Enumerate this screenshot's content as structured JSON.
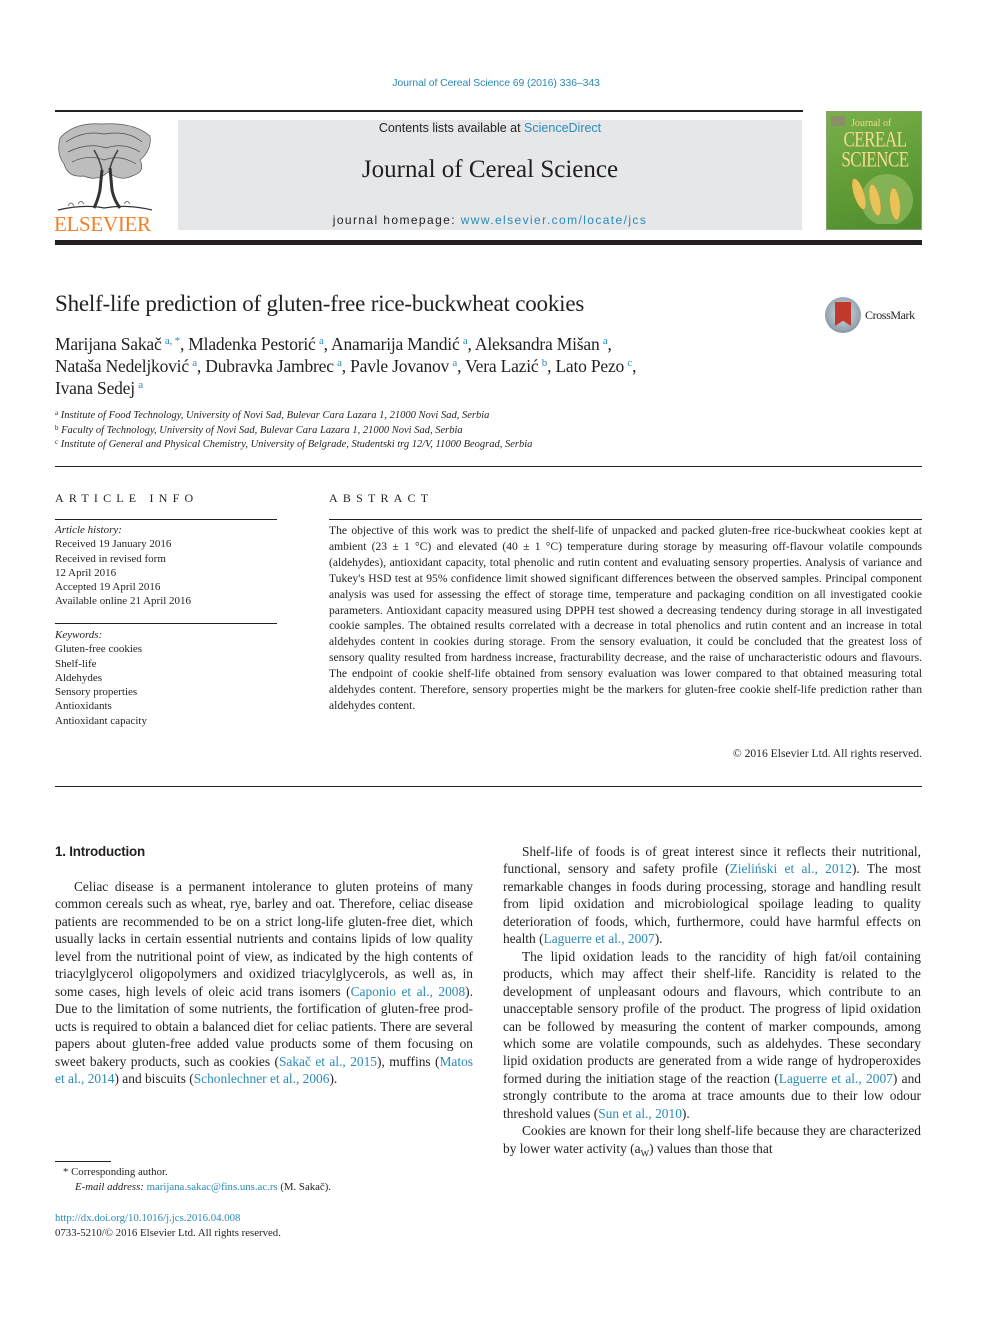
{
  "running_head": "Journal of Cereal Science 69 (2016) 336–343",
  "masthead": {
    "publisher_logo_text": "ELSEVIER",
    "contents_prefix": "Contents lists available at ",
    "contents_link": "ScienceDirect",
    "journal_title": "Journal of Cereal Science",
    "homepage_prefix": "journal homepage: ",
    "homepage_link": "www.elsevier.com/locate/jcs",
    "cover": {
      "line1": "Journal of",
      "line2": "CEREAL",
      "line3": "SCIENCE"
    }
  },
  "article": {
    "title": "Shelf-life prediction of gluten-free rice-buckwheat cookies",
    "crossmark_label": "CrossMark",
    "authors": [
      {
        "name": "Marijana Sakač",
        "aff": "a, *",
        "sep": ", "
      },
      {
        "name": "Mladenka Pestorić",
        "aff": "a",
        "sep": ", "
      },
      {
        "name": "Anamarija Mandić",
        "aff": "a",
        "sep": ", "
      },
      {
        "name": "Aleksandra Mišan",
        "aff": "a",
        "sep": ","
      },
      {
        "name": "Nataša Nedeljković",
        "aff": "a",
        "sep": ", "
      },
      {
        "name": "Dubravka Jambrec",
        "aff": "a",
        "sep": ", "
      },
      {
        "name": "Pavle Jovanov",
        "aff": "a",
        "sep": ", "
      },
      {
        "name": "Vera Lazić",
        "aff": "b",
        "sep": ", "
      },
      {
        "name": "Lato Pezo",
        "aff": "c",
        "sep": ","
      },
      {
        "name": "Ivana Sedej",
        "aff": "a",
        "sep": ""
      }
    ],
    "affiliations": [
      {
        "key": "a",
        "text": "Institute of Food Technology, University of Novi Sad, Bulevar Cara Lazara 1, 21000 Novi Sad, Serbia"
      },
      {
        "key": "b",
        "text": "Faculty of Technology, University of Novi Sad, Bulevar Cara Lazara 1, 21000 Novi Sad, Serbia"
      },
      {
        "key": "c",
        "text": "Institute of General and Physical Chemistry, University of Belgrade, Studentski trg 12/V, 11000 Beograd, Serbia"
      }
    ]
  },
  "article_info": {
    "heading": "ARTICLE INFO",
    "history_label": "Article history:",
    "history": [
      "Received 19 January 2016",
      "Received in revised form",
      "12 April 2016",
      "Accepted 19 April 2016",
      "Available online 21 April 2016"
    ],
    "keywords_label": "Keywords:",
    "keywords": [
      "Gluten-free cookies",
      "Shelf-life",
      "Aldehydes",
      "Sensory properties",
      "Antioxidants",
      "Antioxidant capacity"
    ]
  },
  "abstract": {
    "heading": "ABSTRACT",
    "text": "The objective of this work was to predict the shelf-life of unpacked and packed gluten-free rice-buck­wheat cookies kept at ambient (23 ± 1 °C) and elevated (40 ± 1 °C) temperature during storage by measuring off-flavour volatile compounds (aldehydes), antioxidant capacity, total phenolic and rutin content and evaluating sensory properties. Analysis of variance and Tukey's HSD test at 95% confidence limit showed significant differences between the observed samples. Principal component analysis was used for assessing the effect of storage time, temperature and packaging condition on all investigated cookie parameters. Antioxidant capacity measured using DPPH test showed a decreasing tendency during storage in all investigated cookie samples. The obtained results correlated with a decrease in total phenolics and rutin content and an increase in total aldehydes content in cookies during storage. From the sensory evaluation, it could be concluded that the greatest loss of sensory quality resulted from hardness increase, fracturability decrease, and the raise of uncharacteristic odours and flavours. The end­point of cookie shelf-life obtained from sensory evaluation was lower compared to that obtained measuring total aldehydes content. Therefore, sensory properties might be the markers for gluten-free cookie shelf-life prediction rather than aldehydes content.",
    "copyright": "© 2016 Elsevier Ltd. All rights reserved."
  },
  "body": {
    "section_heading": "1.  Introduction",
    "left_paragraphs": [
      [
        {
          "t": "Celiac disease is a permanent intolerance to gluten proteins of many common cereals such as wheat, rye, barley and oat. Therefore, celiac disease patients are recommended to be on a strict long-life gluten-free diet, which usually lacks in certain essential nutrients and contains lipids of low quality level from the nutritional point of view, as indicated by the high contents of triacylglycerol oligopol­ymers and oxidized triacylglycerols, as well as, in some cases, high levels of oleic acid trans isomers ("
        },
        {
          "t": "Caponio et al., 2008",
          "link": true
        },
        {
          "t": "). Due to the limitation of some nutrients, the fortification of gluten-free prod­ucts is required to obtain a balanced diet for celiac patients. There are several papers about gluten-free added value products some of them focusing on sweet bakery products, such as cookies ("
        },
        {
          "t": "Sakač et al., 2015",
          "link": true
        },
        {
          "t": "), muffins ("
        },
        {
          "t": "Matos et al., 2014",
          "link": true
        },
        {
          "t": ") and biscuits ("
        },
        {
          "t": "Schonlechner et al., 2006",
          "link": true
        },
        {
          "t": ")."
        }
      ]
    ],
    "right_paragraphs": [
      [
        {
          "t": "Shelf-life of foods is of great interest since it reflects their nutritional, functional, sensory and safety profile ("
        },
        {
          "t": "Zieliński et al., 2012",
          "link": true
        },
        {
          "t": "). The most remarkable changes in foods during processing, storage and handling result from lipid oxidation and microbiolog­ical spoilage leading to quality deterioration of foods, which, furthermore, could have harmful effects on health ("
        },
        {
          "t": "Laguerre et al., 2007",
          "link": true
        },
        {
          "t": ")."
        }
      ],
      [
        {
          "t": "The lipid oxidation leads to the rancidity of high fat/oil con­taining products, which may affect their shelf-life. Rancidity is related to the development of unpleasant odours and flavours, which contribute to an unacceptable sensory profile of the product. The progress of lipid oxidation can be followed by measuring the content of marker compounds, among which some are volatile compounds, such as aldehydes. These secondary lipid oxidation products are generated from a wide range of hydroperoxides formed during the initiation stage of the reaction ("
        },
        {
          "t": "Laguerre et al., 2007",
          "link": true
        },
        {
          "t": ") and strongly contribute to the aroma at trace amounts due to their low odour threshold values ("
        },
        {
          "t": "Sun et al., 2010",
          "link": true
        },
        {
          "t": ")."
        }
      ],
      [
        {
          "t": "Cookies are known for their long shelf-life because they are characterized by lower water activity (a"
        },
        {
          "t": "W",
          "sub": true
        },
        {
          "t": ") values than those that"
        }
      ]
    ]
  },
  "footnotes": {
    "corresponding_mark": "*",
    "corresponding_text": "Corresponding author.",
    "email_label": "E-mail address:",
    "email": "marijana.sakac@fins.uns.ac.rs",
    "email_suffix": " (M. Sakač).",
    "doi_link": "http://dx.doi.org/10.1016/j.jcs.2016.04.008",
    "issn_line": "0733-5210/© 2016 Elsevier Ltd. All rights reserved."
  },
  "colors": {
    "link": "#2a8ab6",
    "elsevier_orange": "#f47f24",
    "masthead_gray": "#e6e7e8",
    "text": "#231f20"
  }
}
